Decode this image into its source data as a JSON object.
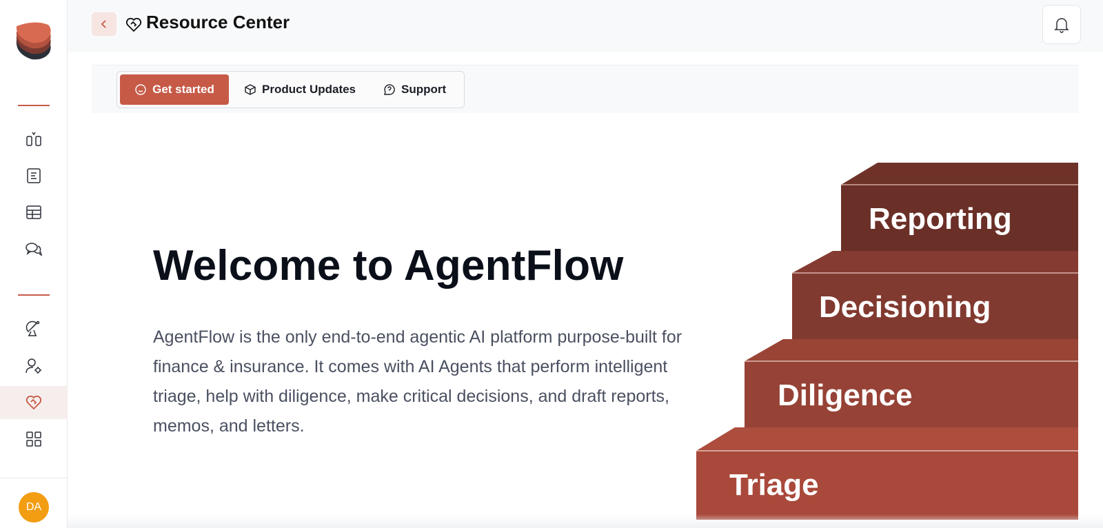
{
  "header": {
    "title": "Resource Center"
  },
  "tabs": [
    {
      "label": "Get started",
      "icon": "smile-icon",
      "active": true
    },
    {
      "label": "Product Updates",
      "icon": "package-icon",
      "active": false
    },
    {
      "label": "Support",
      "icon": "help-circle-icon",
      "active": false
    }
  ],
  "hero": {
    "title": "Welcome to AgentFlow",
    "description": "AgentFlow is the only end-to-end agentic AI platform purpose-built for finance & insurance. It comes with AI Agents that perform intelligent triage, help with diligence, make critical decisions, and draft reports, memos, and letters."
  },
  "stairs": {
    "steps": [
      "Reporting",
      "Decisioning",
      "Diligence",
      "Triage"
    ]
  },
  "sidebar": {
    "items": [
      {
        "icon": "compare-icon"
      },
      {
        "icon": "document-icon"
      },
      {
        "icon": "table-icon"
      },
      {
        "icon": "chat-icon"
      },
      {
        "icon": "satellite-icon"
      },
      {
        "icon": "user-settings-icon"
      },
      {
        "icon": "heart-handshake-icon",
        "active": true
      },
      {
        "icon": "apps-grid-icon"
      }
    ]
  },
  "user": {
    "initials": "DA"
  },
  "colors": {
    "accent": "#c65a47",
    "avatar": "#f29d12",
    "stair_top": "#6e3229",
    "stair_bottom": "#a9493b"
  }
}
